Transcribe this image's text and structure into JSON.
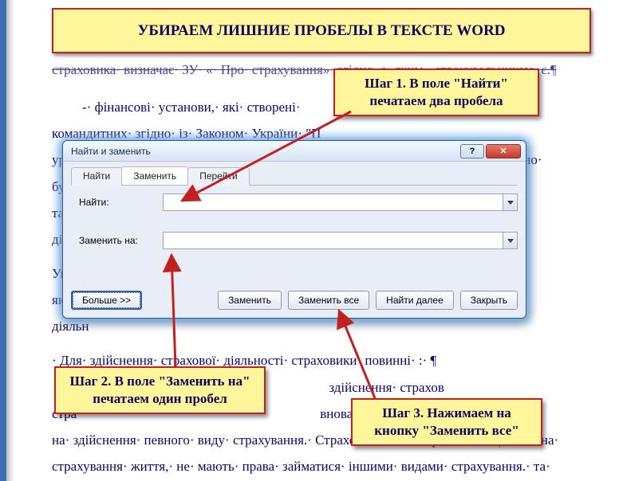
{
  "title": "УБИРАЕМ ЛИШНИЕ ПРОБЕЛЫ В ТЕКСТЕ WORD",
  "doc": {
    "top_cut": "страховика· визначає· ЗУ· «· Про· страхування»· згідно· з· яким,· страхувальником· є.¶",
    "p1_line1": "-· фінансові· установи,· які· створені·",
    "p1_line2": "командитних· згідно· із· Законом· України· \"П",
    "p1_line3": "урахуванням· того,· що· учасників· кожної· з· таких· фінансових· установ· повинно·",
    "p1_line4": "бути·",
    "p1_line5": "також",
    "p1_line6": "діяль",
    "p2a": "Україн",
    "p2b": "які· од",
    "p2c": "діяльн",
    "p3": "· Для· здійснення· страхової· діяльності· страховики· повинні· :· ¶",
    "p4_line1": "-·",
    "p4_line1b": "здійснення· страхов",
    "p4_line2a": "стра",
    "p4_line2b": "вноваженим",
    "p4_line3": "на· здійснення· певного· виду· страхування.· Страховики,· які· отримали· ліцензію· на·",
    "p4_line4": "страхування· життя,· не· мають· права· займатися· іншими· видами· страхування.· та·"
  },
  "dialog": {
    "title": "Найти и заменить",
    "tabs": {
      "find": "Найти",
      "replace": "Заменить",
      "goto": "Перейти"
    },
    "find_label": "Найти:",
    "replace_label": "Заменить на:",
    "buttons": {
      "more": "Больше >>",
      "replace": "Заменить",
      "replace_all": "Заменить все",
      "find_next": "Найти далее",
      "close": "Закрыть"
    },
    "help": "?",
    "close_x": "✕"
  },
  "callouts": {
    "step1": "Шаг 1. В поле \"Найти\" печатаем два пробела",
    "step2": "Шаг 2. В поле \"Заменить на\" печатаем один пробел",
    "step3": "Шаг 3. Нажимаем на кнопку \"Заменить все\""
  }
}
